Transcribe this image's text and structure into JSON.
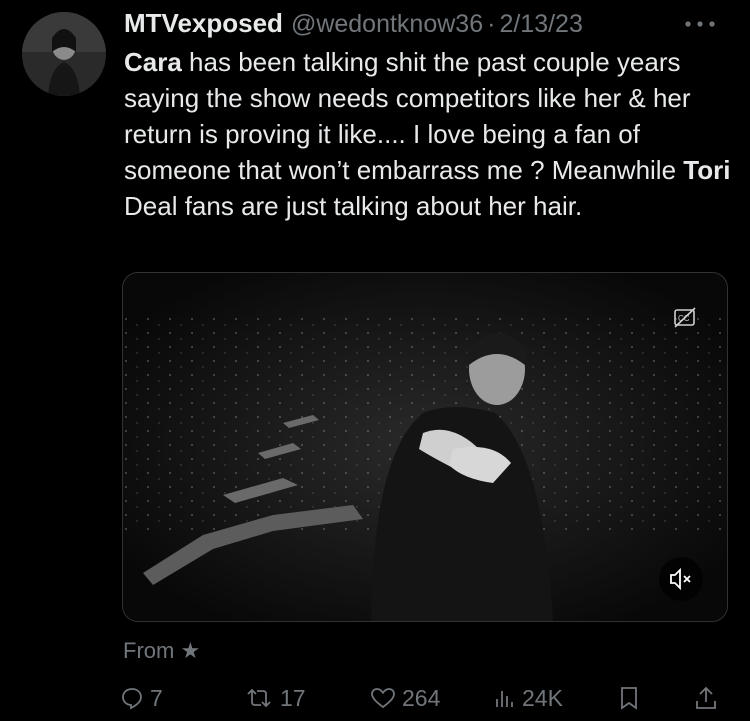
{
  "tweet": {
    "display_name": "MTVexposed",
    "handle": "@wedontknow36",
    "separator": "·",
    "date": "2/13/23",
    "text_segments": [
      {
        "t": "Cara",
        "bold": true
      },
      {
        "t": " has been talking shit the past couple years saying the show needs competitors like her & her return is proving it like.... I love being a fan of someone that won’t embarrass me ? Meanwhile ",
        "bold": false
      },
      {
        "t": "Tori",
        "bold": true
      },
      {
        "t": " Deal fans are just talking about her hair.",
        "bold": false
      }
    ],
    "from_label": "From ★"
  },
  "media": {
    "type": "video",
    "captions_icon": "closed-captions-icon",
    "mute_icon": "speaker-muted-icon"
  },
  "actions": {
    "replies": "7",
    "retweets": "17",
    "likes": "264",
    "views": "24K",
    "icons": [
      "reply-icon",
      "retweet-icon",
      "like-icon",
      "views-icon",
      "bookmark-icon",
      "share-icon"
    ]
  },
  "colors": {
    "background": "#000000",
    "text_primary": "#e7e9ea",
    "text_secondary": "#71767b",
    "border": "#2f3336"
  }
}
